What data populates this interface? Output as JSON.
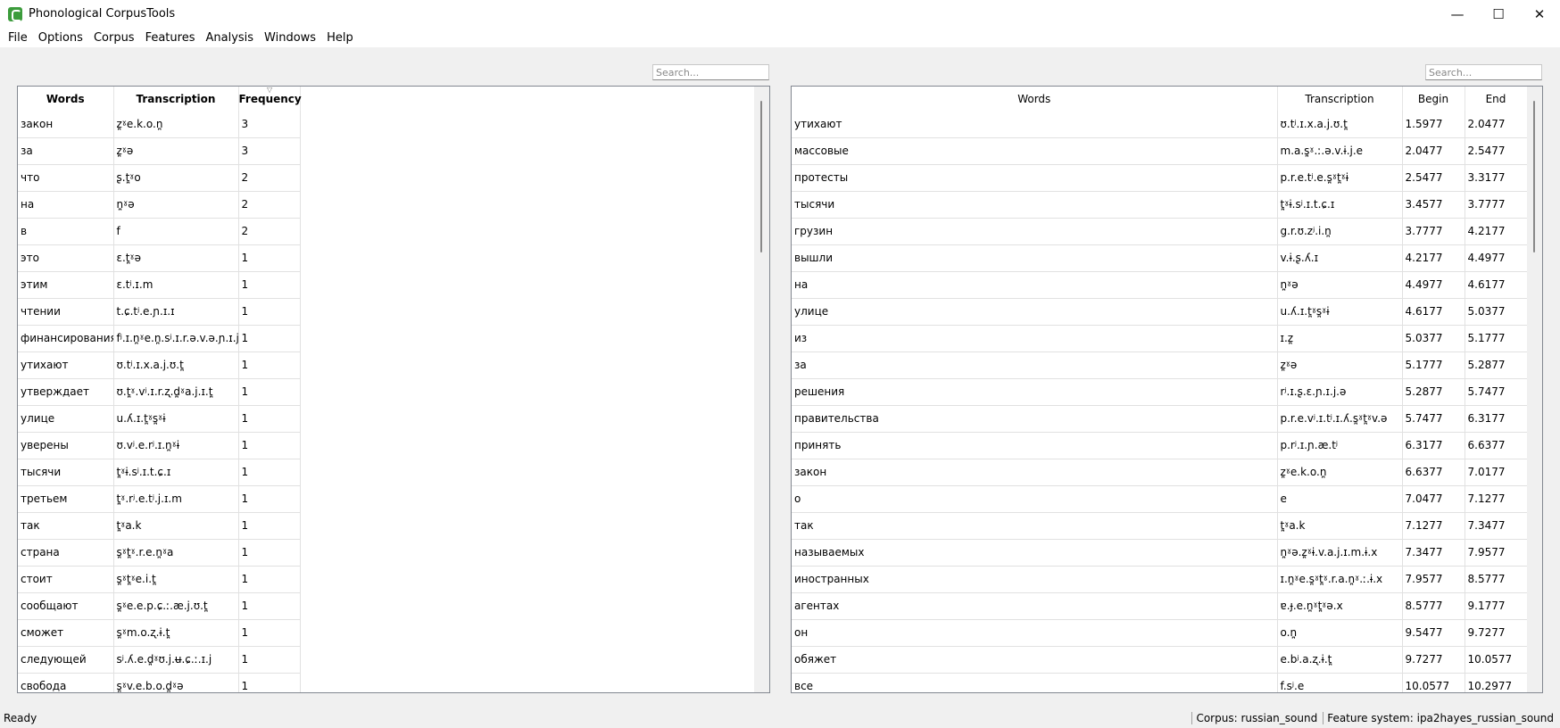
{
  "window": {
    "title": "Phonological CorpusTools",
    "minimize": "—",
    "maximize": "☐",
    "close": "✕"
  },
  "menu": [
    "File",
    "Options",
    "Corpus",
    "Features",
    "Analysis",
    "Windows",
    "Help"
  ],
  "left_search": {
    "placeholder": "Search..."
  },
  "right_search": {
    "placeholder": "Search..."
  },
  "left_table": {
    "headers": [
      "Words",
      "Transcription",
      "Frequency"
    ],
    "rows": [
      [
        "закон",
        "z̪ˠe.k.o.n̪",
        "3"
      ],
      [
        "за",
        "z̪ˠə",
        "3"
      ],
      [
        "что",
        "ʂ.t̪ˠo",
        "2"
      ],
      [
        "на",
        "n̪ˠə",
        "2"
      ],
      [
        "в",
        "f",
        "2"
      ],
      [
        "это",
        "ɛ.t̪ˠə",
        "1"
      ],
      [
        "этим",
        "ɛ.tʲ.ɪ.m",
        "1"
      ],
      [
        "чтении",
        "t.ɕ.tʲ.e.ɲ.ɪ.ɪ",
        "1"
      ],
      [
        "финансирования",
        "fʲ.ɪ.n̪ˠe.n̪.sʲ.ɪ.r.ə.v.ə.ɲ.ɪ.j.ə",
        "1"
      ],
      [
        "утихают",
        "ʊ.tʲ.ɪ.x.a.j.ʊ.t̪",
        "1"
      ],
      [
        "утверждает",
        "ʊ.t̪ˠ.vʲ.ɪ.r.ʐ.d̪ˠa.j.ɪ.t̪",
        "1"
      ],
      [
        "улице",
        "u.ʎ.ɪ.t̪ˠs̪ˠɨ",
        "1"
      ],
      [
        "уверены",
        "ʊ.vʲ.e.rʲ.ɪ.n̪ˠɨ",
        "1"
      ],
      [
        "тысячи",
        "t̪ˠɨ.sʲ.ɪ.t.ɕ.ɪ",
        "1"
      ],
      [
        "третьем",
        "t̪ˠ.rʲ.e.tʲ.j.ɪ.m",
        "1"
      ],
      [
        "так",
        "t̪ˠa.k",
        "1"
      ],
      [
        "страна",
        "s̪ˠt̪ˠ.r.e.n̪ˠa",
        "1"
      ],
      [
        "стоит",
        "s̪ˠt̪ˠe.i.t̪",
        "1"
      ],
      [
        "сообщают",
        "s̪ˠe.e.p.ɕ.ː.æ.j.ʊ.t̪",
        "1"
      ],
      [
        "сможет",
        "s̪ˠm.o.ʐ.ɨ.t̪",
        "1"
      ],
      [
        "следующей",
        "sʲ.ʎ.e.d̪ˠʊ.j.ʉ.ɕ.ː.ɪ.j",
        "1"
      ],
      [
        "свобода",
        "s̪ˠv.e.b.o.d̪ˠə",
        "1"
      ]
    ]
  },
  "right_table": {
    "headers": [
      "Words",
      "Transcription",
      "Begin",
      "End"
    ],
    "rows": [
      [
        "утихают",
        "ʊ.tʲ.ɪ.x.a.j.ʊ.t̪",
        "1.5977",
        "2.0477"
      ],
      [
        "массовые",
        "m.a.s̪ˠ.ː.ə.v.ɨ.j.e",
        "2.0477",
        "2.5477"
      ],
      [
        "протесты",
        "p.r.e.tʲ.e.s̪ˠt̪ˠɨ",
        "2.5477",
        "3.3177"
      ],
      [
        "тысячи",
        "t̪ˠɨ.sʲ.ɪ.t.ɕ.ɪ",
        "3.4577",
        "3.7777"
      ],
      [
        "грузин",
        "g.r.ʊ.zʲ.i.n̪",
        "3.7777",
        "4.2177"
      ],
      [
        "вышли",
        "v.ɨ.ʂ.ʎ.ɪ",
        "4.2177",
        "4.4977"
      ],
      [
        "на",
        "n̪ˠə",
        "4.4977",
        "4.6177"
      ],
      [
        "улице",
        "u.ʎ.ɪ.t̪ˠs̪ˠɨ",
        "4.6177",
        "5.0377"
      ],
      [
        "из",
        "ɪ.z̪",
        "5.0377",
        "5.1777"
      ],
      [
        "за",
        "z̪ˠə",
        "5.1777",
        "5.2877"
      ],
      [
        "решения",
        "rʲ.ɪ.ʂ.ɛ.ɲ.ɪ.j.ə",
        "5.2877",
        "5.7477"
      ],
      [
        "правительства",
        "p.r.e.vʲ.ɪ.tʲ.ɪ.ʎ.s̪ˠt̪ˠv.ə",
        "5.7477",
        "6.3177"
      ],
      [
        "принять",
        "p.rʲ.ɪ.ɲ.æ.tʲ",
        "6.3177",
        "6.6377"
      ],
      [
        "закон",
        "z̪ˠe.k.o.n̪",
        "6.6377",
        "7.0177"
      ],
      [
        "о",
        "e",
        "7.0477",
        "7.1277"
      ],
      [
        "так",
        "t̪ˠa.k",
        "7.1277",
        "7.3477"
      ],
      [
        "называемых",
        "n̪ˠə.z̪ˠɨ.v.a.j.ɪ.m.ɨ.x",
        "7.3477",
        "7.9577"
      ],
      [
        "иностранных",
        "ɪ.n̪ˠe.s̪ˠt̪ˠ.r.a.n̪ˠ.ː.ɨ.x",
        "7.9577",
        "8.5777"
      ],
      [
        "агентах",
        "ɐ.ɟ.e.n̪ˠt̪ˠə.x",
        "8.5777",
        "9.1777"
      ],
      [
        "он",
        "o.n̪",
        "9.5477",
        "9.7277"
      ],
      [
        "обяжет",
        "e.bʲ.a.ʐ.ɨ.t̪",
        "9.7277",
        "10.0577"
      ],
      [
        "все",
        "f.sʲ.e",
        "10.0577",
        "10.2977"
      ]
    ]
  },
  "status": {
    "ready": "Ready",
    "corpus": "Corpus: russian_sound",
    "feature_system": "Feature system: ipa2hayes_russian_sound"
  }
}
